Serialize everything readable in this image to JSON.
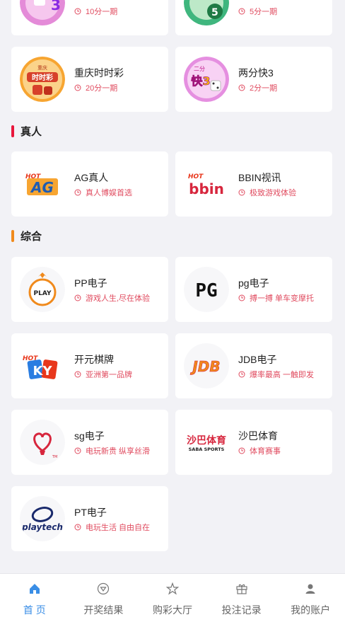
{
  "sections": {
    "live": {
      "title": "真人",
      "color": "#e8173c"
    },
    "general": {
      "title": "综合",
      "color": "#f08a1c"
    }
  },
  "cards": [
    {
      "name": "",
      "sub": "10分一期",
      "logo": "lottery-3-logo"
    },
    {
      "name": "",
      "sub": "5分一期",
      "logo": "lottery-5-logo"
    },
    {
      "name": "重庆时时彩",
      "sub": "20分一期",
      "logo": "cqssc-logo",
      "logo_text": "时时彩",
      "logo_top": "重庆"
    },
    {
      "name": "两分快3",
      "sub": "2分一期",
      "logo": "k3-logo",
      "logo_text": "快3",
      "logo_top": "二分"
    },
    {
      "name": "AG真人",
      "sub": "真人博娱首选",
      "logo": "ag-logo",
      "logo_text": "AG",
      "logo_top": "HOT"
    },
    {
      "name": "BBIN视讯",
      "sub": "极致游戏体验",
      "logo": "bbin-logo",
      "logo_text": "bbin",
      "logo_top": "HOT"
    },
    {
      "name": "PP电子",
      "sub": "游戏人生,尽在体验",
      "logo": "pp-logo",
      "logo_text": "PLAY"
    },
    {
      "name": "pg电子",
      "sub": "搏一搏 单车变摩托",
      "logo": "pg-logo",
      "logo_text": "PG"
    },
    {
      "name": "开元棋牌",
      "sub": "亚洲第一品牌",
      "logo": "ky-logo",
      "logo_text": "KY",
      "logo_top": "HOT"
    },
    {
      "name": "JDB电子",
      "sub": "爆率最高 一触即发",
      "logo": "jdb-logo",
      "logo_text": "JDB"
    },
    {
      "name": "sg电子",
      "sub": "电玩新贵 纵享丝滑",
      "logo": "sg-logo",
      "logo_text": "TM"
    },
    {
      "name": "沙巴体育",
      "sub": "体育赛事",
      "logo": "saba-logo",
      "logo_text": "沙巴体育",
      "logo_sub": "SABA SPORTS"
    },
    {
      "name": "PT电子",
      "sub": "电玩生活 自由自在",
      "logo": "playtech-logo",
      "logo_text": "playtech"
    }
  ],
  "nav": {
    "items": [
      {
        "label": "首 页",
        "icon": "home-icon",
        "active": true
      },
      {
        "label": "开奖结果",
        "icon": "result-icon"
      },
      {
        "label": "购彩大厅",
        "icon": "star-icon"
      },
      {
        "label": "投注记录",
        "icon": "gift-icon"
      },
      {
        "label": "我的账户",
        "icon": "user-icon"
      }
    ]
  },
  "colors": {
    "accent": "#3a8ee6",
    "sub_text": "#e04b5f",
    "background": "#f2f2f6"
  }
}
